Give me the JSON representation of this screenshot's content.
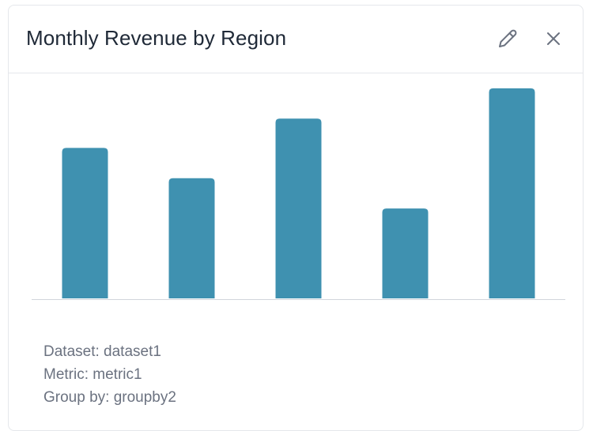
{
  "card": {
    "title": "Monthly Revenue by Region",
    "edit_icon": "pencil-icon",
    "close_icon": "close-icon",
    "accent_color": "#3f91b0",
    "axis_color": "#d1d5db"
  },
  "chart_data": {
    "type": "bar",
    "categories": [
      "",
      "",
      "",
      "",
      ""
    ],
    "values": [
      72,
      57.5,
      86,
      43,
      100.5
    ],
    "ylim": [
      0,
      108
    ],
    "grid": false,
    "title": "",
    "xlabel": "",
    "ylabel": ""
  },
  "details": {
    "dataset_line": "Dataset: dataset1",
    "metric_line": "Metric: metric1",
    "groupby_line": "Group by: groupby2"
  }
}
